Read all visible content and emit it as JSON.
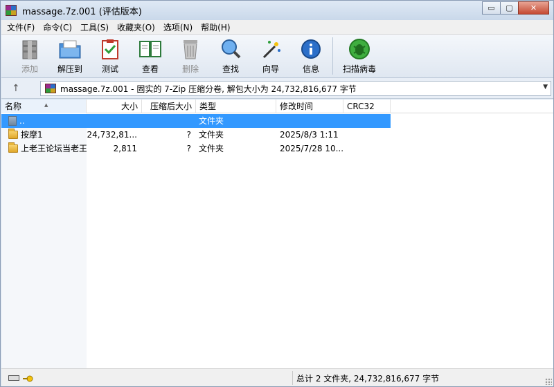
{
  "window": {
    "title": "massage.7z.001 (评估版本)",
    "controls": {
      "minimize": "▭",
      "maximize": "▢",
      "close": "✕"
    }
  },
  "menu": {
    "items": [
      "文件(F)",
      "命令(C)",
      "工具(S)",
      "收藏夹(O)",
      "选项(N)",
      "帮助(H)"
    ]
  },
  "toolbar": {
    "buttons": [
      {
        "label": "添加",
        "icon": "add-archive-icon",
        "disabled": true
      },
      {
        "label": "解压到",
        "icon": "extract-to-icon",
        "disabled": false
      },
      {
        "label": "测试",
        "icon": "test-icon",
        "disabled": false
      },
      {
        "label": "查看",
        "icon": "view-book-icon",
        "disabled": false
      },
      {
        "label": "删除",
        "icon": "delete-trash-icon",
        "disabled": true
      },
      {
        "label": "查找",
        "icon": "find-magnifier-icon",
        "disabled": false
      },
      {
        "label": "向导",
        "icon": "wizard-wand-icon",
        "disabled": false
      },
      {
        "label": "信息",
        "icon": "info-icon",
        "disabled": false
      },
      {
        "label": "扫描病毒",
        "icon": "virus-scan-icon",
        "disabled": false
      }
    ]
  },
  "address": {
    "path": "massage.7z.001 - 固实的 7-Zip 压缩分卷, 解包大小为 24,732,816,677 字节"
  },
  "columns": {
    "name": "名称",
    "size": "大小",
    "packed": "压缩后大小",
    "type": "类型",
    "modified": "修改时间",
    "crc": "CRC32"
  },
  "rows": [
    {
      "name": "..",
      "size": "",
      "packed": "",
      "type": "文件夹",
      "modified": "",
      "crc": "",
      "selected": true,
      "kind": "updir"
    },
    {
      "name": "按摩1",
      "size": "24,732,81...",
      "packed": "?",
      "type": "文件夹",
      "modified": "2025/8/3 1:11",
      "crc": "",
      "selected": false,
      "kind": "folder"
    },
    {
      "name": "上老王论坛当老王",
      "size": "2,811",
      "packed": "?",
      "type": "文件夹",
      "modified": "2025/7/28 10...",
      "crc": "",
      "selected": false,
      "kind": "folder"
    }
  ],
  "status": {
    "summary": "总计 2 文件夹, 24,732,816,677 字节"
  },
  "colors": {
    "selection": "#3399ff",
    "toolbar_bg": "#dfe7f1",
    "title_bg": "#c9d8ea"
  }
}
